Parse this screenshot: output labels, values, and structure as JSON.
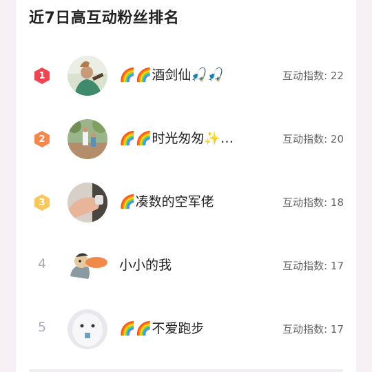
{
  "section_title": "近7日高互动粉丝排名",
  "score_prefix": "互动指数:",
  "colors": {
    "rank1": "#f0454f",
    "rank2": "#f5874c",
    "rank3": "#f9c85a",
    "plain_rank": "#a9a9bf"
  },
  "fans": [
    {
      "rank": "1",
      "name": "🌈🌈酒剑仙🎣🎣",
      "score": "22",
      "avatar_icon": "avatar-person-drinking"
    },
    {
      "rank": "2",
      "name": "🌈🌈时光匆匆✨…",
      "score": "20",
      "avatar_icon": "avatar-outdoor-family"
    },
    {
      "rank": "3",
      "name": "🌈凑数的空军佬",
      "score": "18",
      "avatar_icon": "avatar-hand-closeup"
    },
    {
      "rank": "4",
      "name": "小小的我",
      "score": "17",
      "avatar_icon": "avatar-cartoon-character"
    },
    {
      "rank": "5",
      "name": "🌈🌈不爱跑步",
      "score": "17",
      "avatar_icon": "avatar-white-figure"
    }
  ]
}
